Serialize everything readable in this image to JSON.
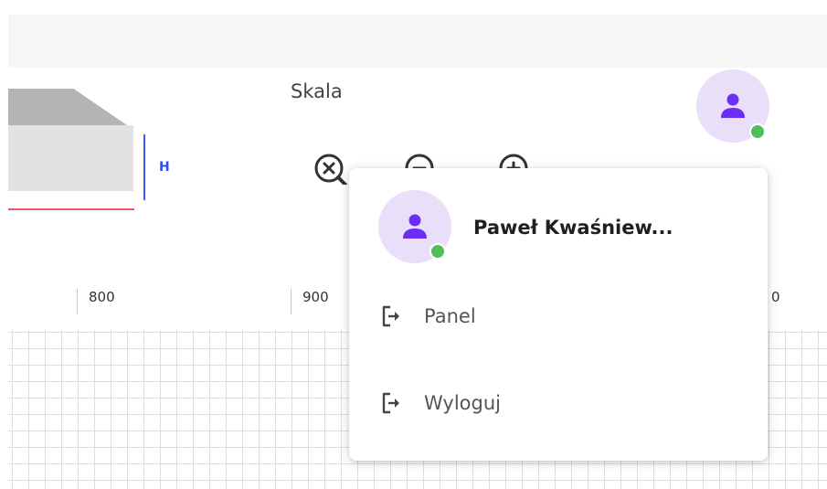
{
  "colors": {
    "accent": "#6b2ef5",
    "avatar_bg": "#eadff9",
    "online": "#4fbf5a",
    "height_marker": "#2f49ff",
    "width_marker": "#ea5a66"
  },
  "preview": {
    "height_label": "H"
  },
  "scale": {
    "label": "Skala",
    "buttons": [
      {
        "name": "zoom-reset",
        "icon": "zoom-reset-icon"
      },
      {
        "name": "zoom-out",
        "icon": "zoom-out-icon"
      },
      {
        "name": "zoom-in",
        "icon": "zoom-in-icon"
      }
    ]
  },
  "ruler": {
    "labels": [
      "800",
      "900",
      "0"
    ]
  },
  "user": {
    "name": "Paweł Kwaśniew...",
    "status": "online",
    "icon": "user-icon"
  },
  "user_menu": {
    "items": [
      {
        "label": "Panel",
        "icon": "exit-arrow-icon"
      },
      {
        "label": "Wyloguj",
        "icon": "exit-arrow-icon"
      }
    ]
  }
}
